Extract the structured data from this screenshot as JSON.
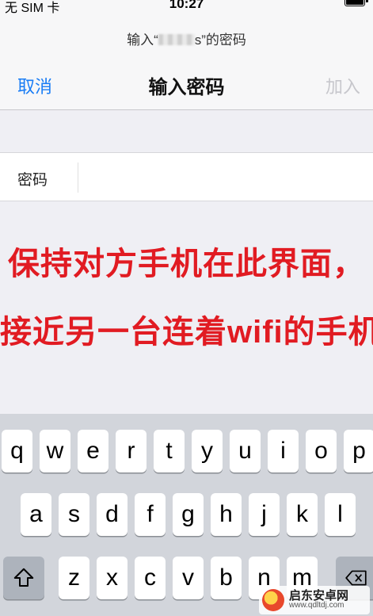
{
  "status_bar": {
    "carrier": "无 SIM 卡",
    "time": "10:27",
    "battery_icon": "battery-full-icon"
  },
  "nav": {
    "prompt_prefix": "输入“",
    "prompt_suffix": "s”的密码",
    "cancel_label": "取消",
    "title": "输入密码",
    "join_label": "加入"
  },
  "password_field": {
    "label": "密码",
    "value": "",
    "placeholder": ""
  },
  "annotation": {
    "line1": "保持对方手机在此界面，",
    "line2": "接近另一台连着wifi的手机",
    "color": "#e11b22"
  },
  "keyboard": {
    "row1": [
      "q",
      "w",
      "e",
      "r",
      "t",
      "y",
      "u",
      "i",
      "o",
      "p"
    ],
    "row2": [
      "a",
      "s",
      "d",
      "f",
      "g",
      "h",
      "j",
      "k",
      "l"
    ],
    "row3": [
      "z",
      "x",
      "c",
      "v",
      "b",
      "n",
      "m"
    ],
    "shift_icon": "shift-icon",
    "delete_icon": "delete-icon"
  },
  "watermark": {
    "name": "启东安卓网",
    "url": "www.qdltdj.com"
  },
  "colors": {
    "link": "#1a7df5",
    "disabled": "#c7c7cc",
    "keyboard_bg": "#d2d5db"
  }
}
